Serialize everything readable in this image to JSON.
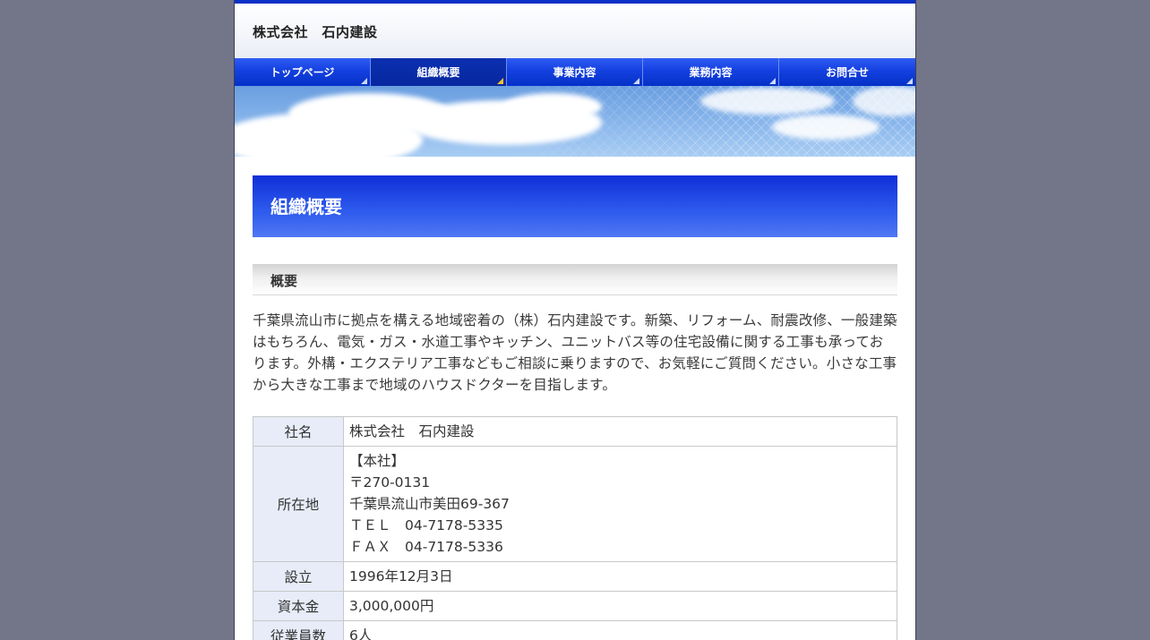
{
  "header": {
    "site_title": "株式会社　石内建設"
  },
  "nav": {
    "items": [
      {
        "label": "トップページ"
      },
      {
        "label": "組織概要"
      },
      {
        "label": "事業内容"
      },
      {
        "label": "業務内容"
      },
      {
        "label": "お問合せ"
      }
    ],
    "active_index": 1
  },
  "main": {
    "page_title": "組織概要",
    "section_title": "概要",
    "intro": "千葉県流山市に拠点を構える地域密着の（株）石内建設です。新築、リフォーム、耐震改修、一般建築はもちろん、電気・ガス・水道工事やキッチン、ユニットバス等の住宅設備に関する工事も承っております。外構・エクステリア工事などもご相談に乗りますので、お気軽にご質問ください。小さな工事から大きな工事まで地域のハウスドクターを目指します。",
    "table": {
      "rows": [
        {
          "label": "社名",
          "lines": [
            "株式会社　石内建設"
          ]
        },
        {
          "label": "所在地",
          "lines": [
            "【本社】",
            "〒270-0131",
            "千葉県流山市美田69-367",
            "ＴＥＬ　04-7178-5335",
            "ＦＡＸ　04-7178-5336"
          ]
        },
        {
          "label": "設立",
          "lines": [
            "1996年12月3日"
          ]
        },
        {
          "label": "資本金",
          "lines": [
            "3,000,000円"
          ]
        },
        {
          "label": "従業員数",
          "lines": [
            "6人"
          ]
        }
      ]
    }
  },
  "colors": {
    "page_background": "#737589",
    "accent_blue": "#0a35d2",
    "table_header_bg": "#e7ecf8",
    "active_marker": "#f2c230"
  }
}
